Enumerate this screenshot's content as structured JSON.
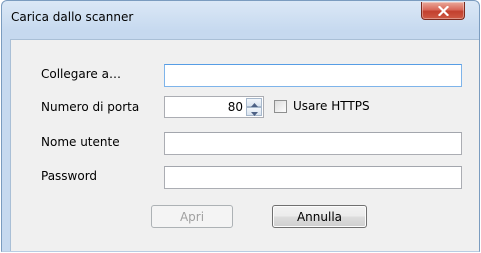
{
  "window": {
    "title": "Carica dallo scanner"
  },
  "form": {
    "connect_label": "Collegare a…",
    "connect_value": "",
    "port_label": "Numero di porta",
    "port_value": "80",
    "https_label": "Usare HTTPS",
    "https_checked": false,
    "username_label": "Nome utente",
    "username_value": "",
    "password_label": "Password",
    "password_value": ""
  },
  "buttons": {
    "open_label": "Apri",
    "open_enabled": false,
    "cancel_label": "Annulla"
  },
  "icons": {
    "close": "close-icon",
    "spin_up": "arrow-up-icon",
    "spin_down": "arrow-down-icon"
  },
  "colors": {
    "titlebar": "#c6d9ef",
    "client": "#f0f0f0",
    "close_button": "#c2402e",
    "focus_border": "#7eb4ea"
  }
}
